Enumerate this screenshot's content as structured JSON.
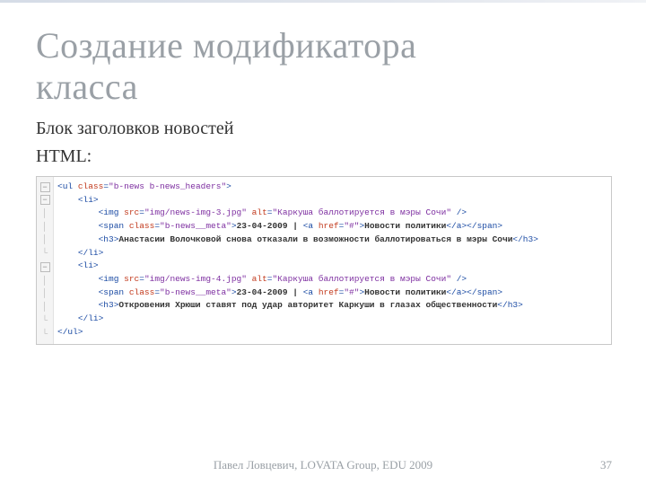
{
  "title_line1": "Создание модификатора",
  "title_line2": "класса",
  "subtitle": "Блок заголовков новостей",
  "label_html": "HTML:",
  "code": {
    "ul_open_1": "<ul ",
    "ul_class_attr": "class",
    "ul_eq": "=",
    "ul_class_val": "\"b-news b-news_headers\"",
    "ul_open_2": ">",
    "li_open": "<li>",
    "img1_open": "<img ",
    "img1_src_attr": "src",
    "img1_src_val": "\"img/news-img-3.jpg\"",
    "img1_alt_attr": "alt",
    "img1_alt_val": "\"Каркуша баллотируется в мэры Сочи\"",
    "img_close": " />",
    "span_open1": "<span ",
    "span_class_attr": "class",
    "span_class_val": "\"b-news__meta\"",
    "span_open2": ">",
    "date": "23-04-2009 ",
    "pipe": "|",
    "a_open1": " <a ",
    "a_href_attr": "href",
    "a_href_val": "\"#\"",
    "a_open2": ">",
    "a_text": "Новости политики",
    "a_close": "</a>",
    "span_close": "</span>",
    "h3_open": "<h3>",
    "h3_text1": "Анастасии Волочковой снова отказали в возможности баллотироваться в мэры Сочи",
    "h3_close": "</h3>",
    "li_close": "</li>",
    "img2_src_val": "\"img/news-img-4.jpg\"",
    "h3_text2": "Откровения Хрюши ставят под удар авторитет Каркуши в глазах общественности",
    "ul_close": "</ul>"
  },
  "folds": {
    "minus": "−",
    "bar": "│",
    "corner": "└"
  },
  "footer": "Павел Ловцевич, LOVATA Group, EDU 2009",
  "page_number": "37"
}
